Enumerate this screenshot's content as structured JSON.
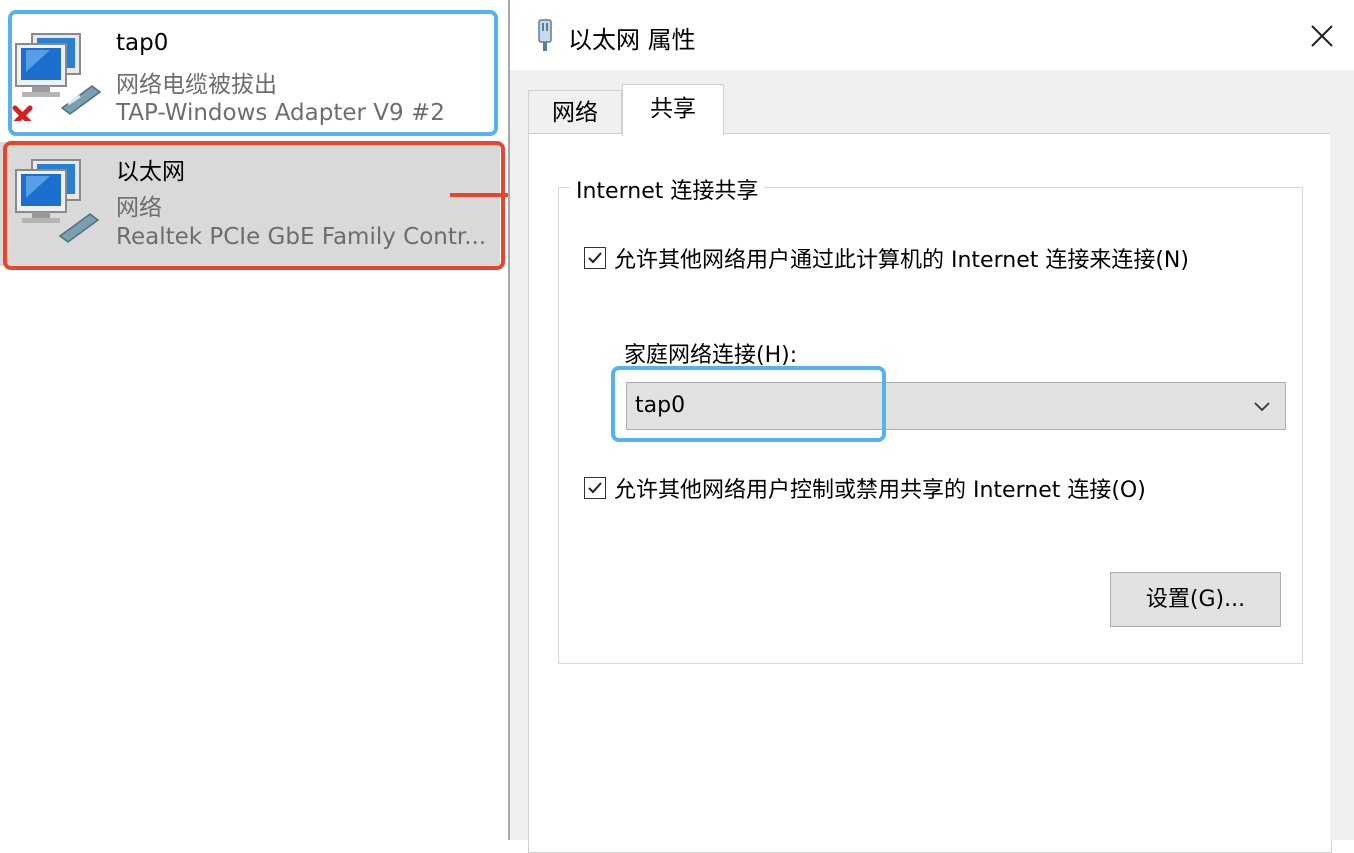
{
  "adapters": [
    {
      "name": "tap0",
      "status": "网络电缆被拔出",
      "device": "TAP-Windows Adapter V9 #2",
      "icon": "network-computers-disconnected-icon"
    },
    {
      "name": "以太网",
      "status": "网络",
      "device": "Realtek PCIe GbE Family Contr...",
      "icon": "network-computers-icon"
    }
  ],
  "dialog": {
    "title": "以太网 属性",
    "tabs": [
      {
        "label": "网络",
        "active": false
      },
      {
        "label": "共享",
        "active": true
      }
    ],
    "sharing": {
      "group_title": "Internet 连接共享",
      "allow_connect": {
        "label": "允许其他网络用户通过此计算机的 Internet 连接来连接(N)",
        "checked": true
      },
      "home_network_label": "家庭网络连接(H):",
      "home_network_value": "tap0",
      "allow_control": {
        "label": "允许其他网络用户控制或禁用共享的 Internet 连接(O)",
        "checked": true
      },
      "settings_button": "设置(G)..."
    }
  },
  "annotations": {
    "highlight_blue": "#55b2ec",
    "highlight_red": "#e8452f"
  }
}
